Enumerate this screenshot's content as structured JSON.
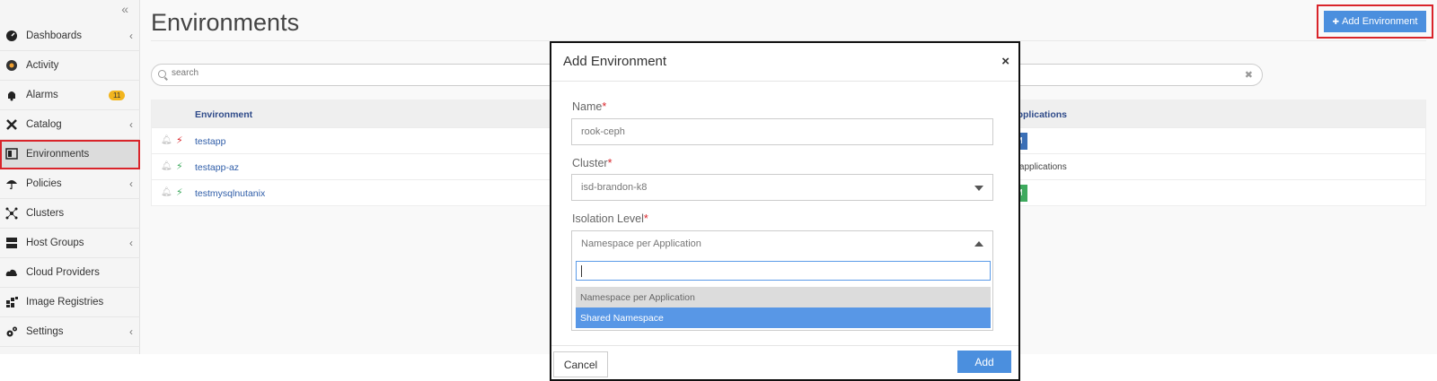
{
  "sidebar": {
    "collapse_glyph": "«",
    "items": [
      {
        "label": "Dashboards",
        "icon": "dashboard-icon",
        "has_submenu": true
      },
      {
        "label": "Activity",
        "icon": "activity-icon",
        "has_submenu": false
      },
      {
        "label": "Alarms",
        "icon": "bell-icon",
        "has_submenu": false,
        "badge": "11"
      },
      {
        "label": "Catalog",
        "icon": "catalog-icon",
        "has_submenu": true
      },
      {
        "label": "Environments",
        "icon": "environments-icon",
        "has_submenu": false,
        "active": true
      },
      {
        "label": "Policies",
        "icon": "umbrella-icon",
        "has_submenu": true
      },
      {
        "label": "Clusters",
        "icon": "clusters-icon",
        "has_submenu": false
      },
      {
        "label": "Host Groups",
        "icon": "server-icon",
        "has_submenu": true
      },
      {
        "label": "Cloud Providers",
        "icon": "cloud-icon",
        "has_submenu": false
      },
      {
        "label": "Image Registries",
        "icon": "registry-icon",
        "has_submenu": false
      },
      {
        "label": "Settings",
        "icon": "cogs-icon",
        "has_submenu": true
      }
    ]
  },
  "header": {
    "title": "Environments",
    "add_button_label": "Add Environment",
    "add_button_glyph": "✚"
  },
  "search": {
    "placeholder": "search",
    "clear_glyph": "✖"
  },
  "table": {
    "columns": [
      "Environment",
      "Applications"
    ],
    "rows": [
      {
        "name": "testapp",
        "status": "disconnected",
        "applications": "M",
        "app_color": "#3b6fb6"
      },
      {
        "name": "testapp-az",
        "status": "connected",
        "applications": "no applications"
      },
      {
        "name": "testmysqlnutanix",
        "status": "connected",
        "applications": "M",
        "app_color": "#3eaa5e"
      }
    ]
  },
  "modal": {
    "title": "Add Environment",
    "close_glyph": "×",
    "name_label": "Name",
    "name_value": "rook-ceph",
    "cluster_label": "Cluster",
    "cluster_value": "isd-brandon-k8",
    "isolation_label": "Isolation Level",
    "isolation_value": "Namespace per Application",
    "required_mark": "*",
    "options": [
      "Namespace per Application",
      "Shared Namespace"
    ],
    "cancel_label": "Cancel",
    "add_label": "Add"
  },
  "colors": {
    "accent": "#4b8fde",
    "highlight": "#d9242a",
    "badge": "#f2b51e",
    "selected_option": "#5897e6"
  }
}
